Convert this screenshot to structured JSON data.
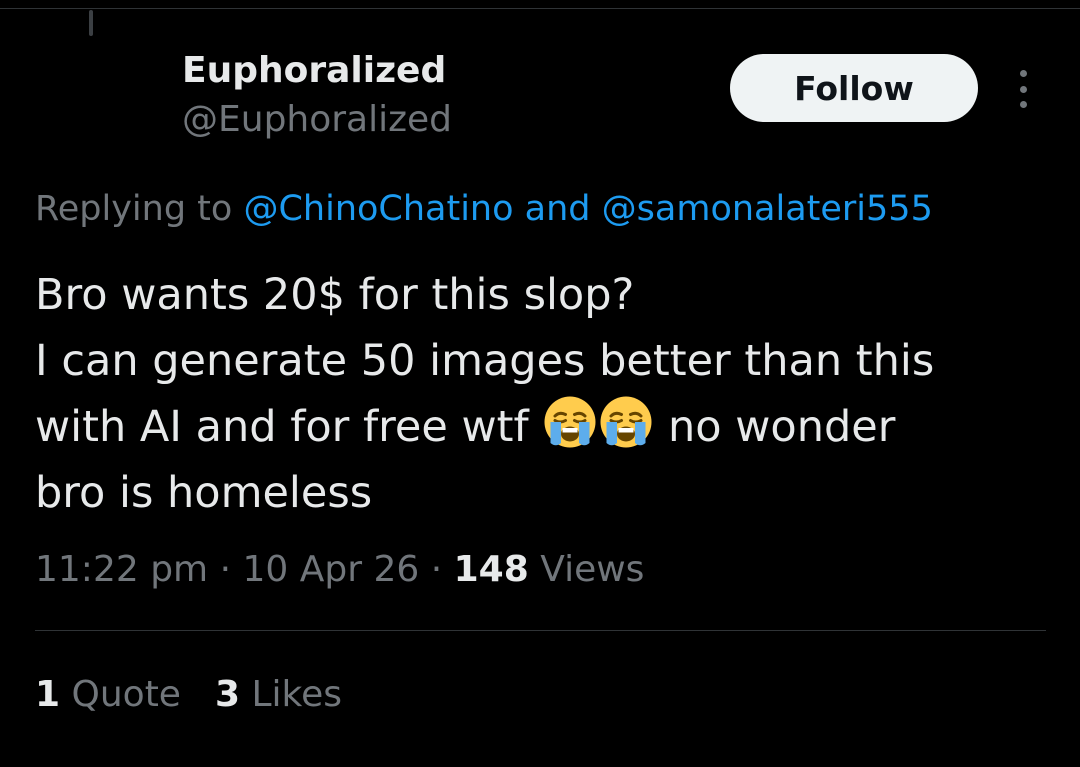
{
  "author": {
    "display_name": "Euphoralized",
    "handle": "@Euphoralized"
  },
  "follow_label": "Follow",
  "more_icon": "more-vertical-icon",
  "reply_context": {
    "prefix": "Replying to",
    "mention_1": "@ChinoChatino",
    "joiner": "and",
    "mention_2": "@samonalateri555"
  },
  "tweet": {
    "line_1": "Bro wants 20$ for this slop?",
    "line_2": "I can generate 50 images better than this",
    "line_3_before": "with AI and for free wtf",
    "emojis": [
      "loudly-crying-face-icon",
      "loudly-crying-face-icon"
    ],
    "line_3_after": "no wonder",
    "line_4": "bro is homeless"
  },
  "meta": {
    "time": "11:22 pm",
    "separator": "·",
    "date": "10 Apr 26",
    "views_count": "148",
    "views_label": "Views"
  },
  "stats": {
    "quotes_count": "1",
    "quotes_label": "Quote",
    "likes_count": "3",
    "likes_label": "Likes"
  },
  "colors": {
    "background": "#000000",
    "text_primary": "#e7e9ea",
    "text_secondary": "#71767b",
    "link": "#1d9bf0",
    "divider": "#2f3336",
    "follow_bg": "#eff3f4"
  }
}
